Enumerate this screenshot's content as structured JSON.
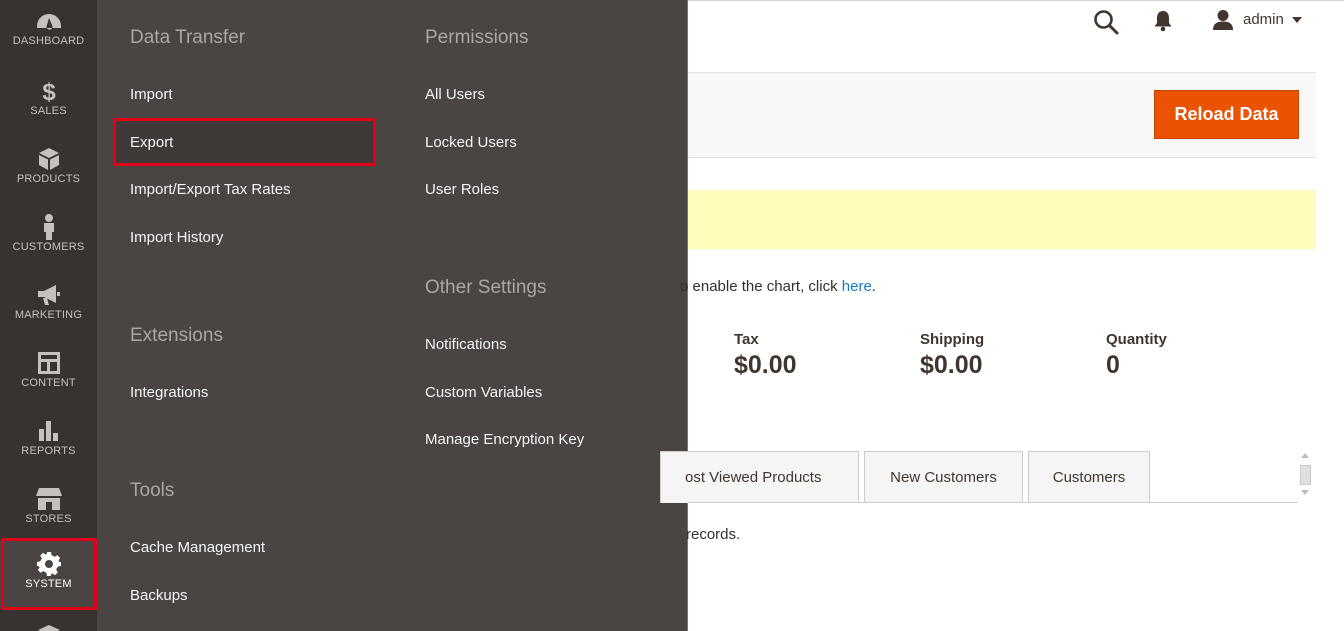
{
  "sidebar": {
    "items": [
      {
        "label": "DASHBOARD",
        "icon": "dashboard-icon"
      },
      {
        "label": "SALES",
        "icon": "dollar-icon"
      },
      {
        "label": "PRODUCTS",
        "icon": "box-icon"
      },
      {
        "label": "CUSTOMERS",
        "icon": "person-icon"
      },
      {
        "label": "MARKETING",
        "icon": "megaphone-icon"
      },
      {
        "label": "CONTENT",
        "icon": "layout-icon"
      },
      {
        "label": "REPORTS",
        "icon": "bar-chart-icon"
      },
      {
        "label": "STORES",
        "icon": "storefront-icon"
      },
      {
        "label": "SYSTEM",
        "icon": "gear-icon"
      }
    ],
    "active": "SYSTEM"
  },
  "flyout": {
    "data_transfer": {
      "title": "Data Transfer",
      "links": [
        "Import",
        "Export",
        "Import/Export Tax Rates",
        "Import History"
      ]
    },
    "extensions": {
      "title": "Extensions",
      "links": [
        "Integrations"
      ]
    },
    "tools": {
      "title": "Tools",
      "links": [
        "Cache Management",
        "Backups"
      ]
    },
    "permissions": {
      "title": "Permissions",
      "links": [
        "All Users",
        "Locked Users",
        "User Roles"
      ]
    },
    "other_settings": {
      "title": "Other Settings",
      "links": [
        "Notifications",
        "Custom Variables",
        "Manage Encryption Key"
      ]
    }
  },
  "header": {
    "user": "admin"
  },
  "actions": {
    "reload": "Reload Data"
  },
  "chart_message": {
    "text": "o enable the chart, click ",
    "link": "here",
    "suffix": "."
  },
  "stats": [
    {
      "label": "Tax",
      "value": "$0.00"
    },
    {
      "label": "Shipping",
      "value": "$0.00"
    },
    {
      "label": "Quantity",
      "value": "0"
    }
  ],
  "tabs": [
    "ost Viewed Products",
    "New Customers",
    "Customers"
  ],
  "records_text": "records.",
  "colors": {
    "sidebar_bg": "#373330",
    "flyout_bg": "#4a4542",
    "accent": "#eb5202",
    "highlight": "#e3001b",
    "notice_bg": "#fffbbb"
  }
}
